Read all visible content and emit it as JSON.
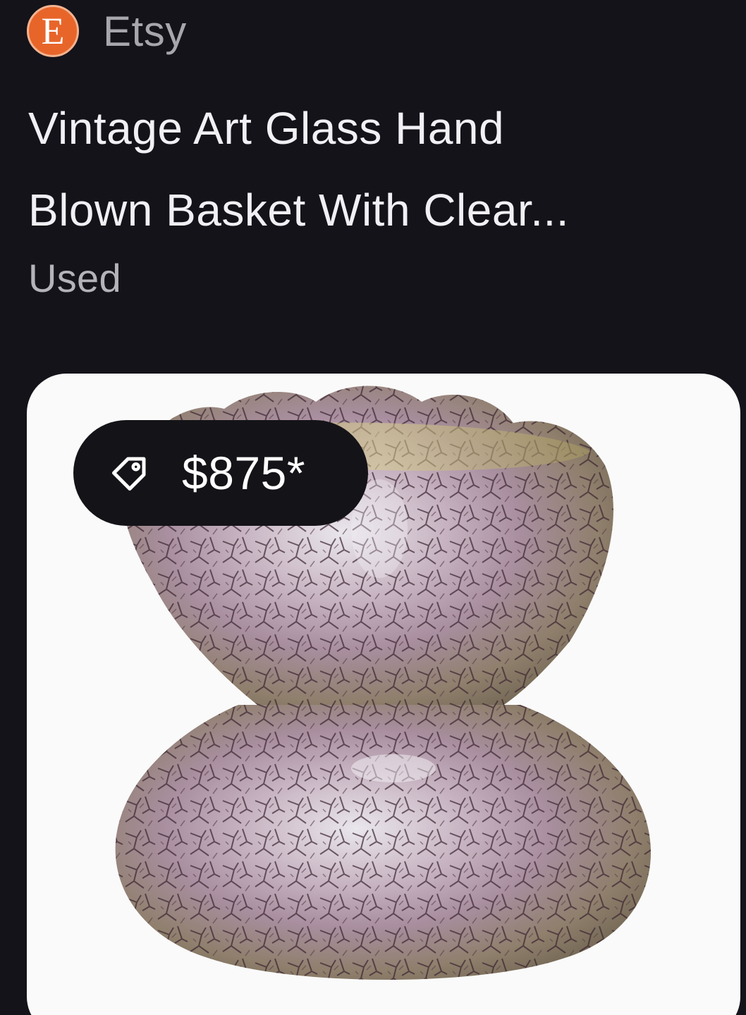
{
  "source": {
    "favicon_letter": "E",
    "name": "Etsy",
    "favicon_color": "#e8652a"
  },
  "listing": {
    "title_lines": [
      "Vintage Art Glass Hand",
      "Blown Basket With Clear..."
    ],
    "condition": "Used",
    "price": "$875*",
    "price_icon": "tag-icon"
  },
  "colors": {
    "background": "#14131a",
    "title_text": "#f1f0f4",
    "secondary_text": "#a8a6ad",
    "badge_background": "#141318"
  }
}
